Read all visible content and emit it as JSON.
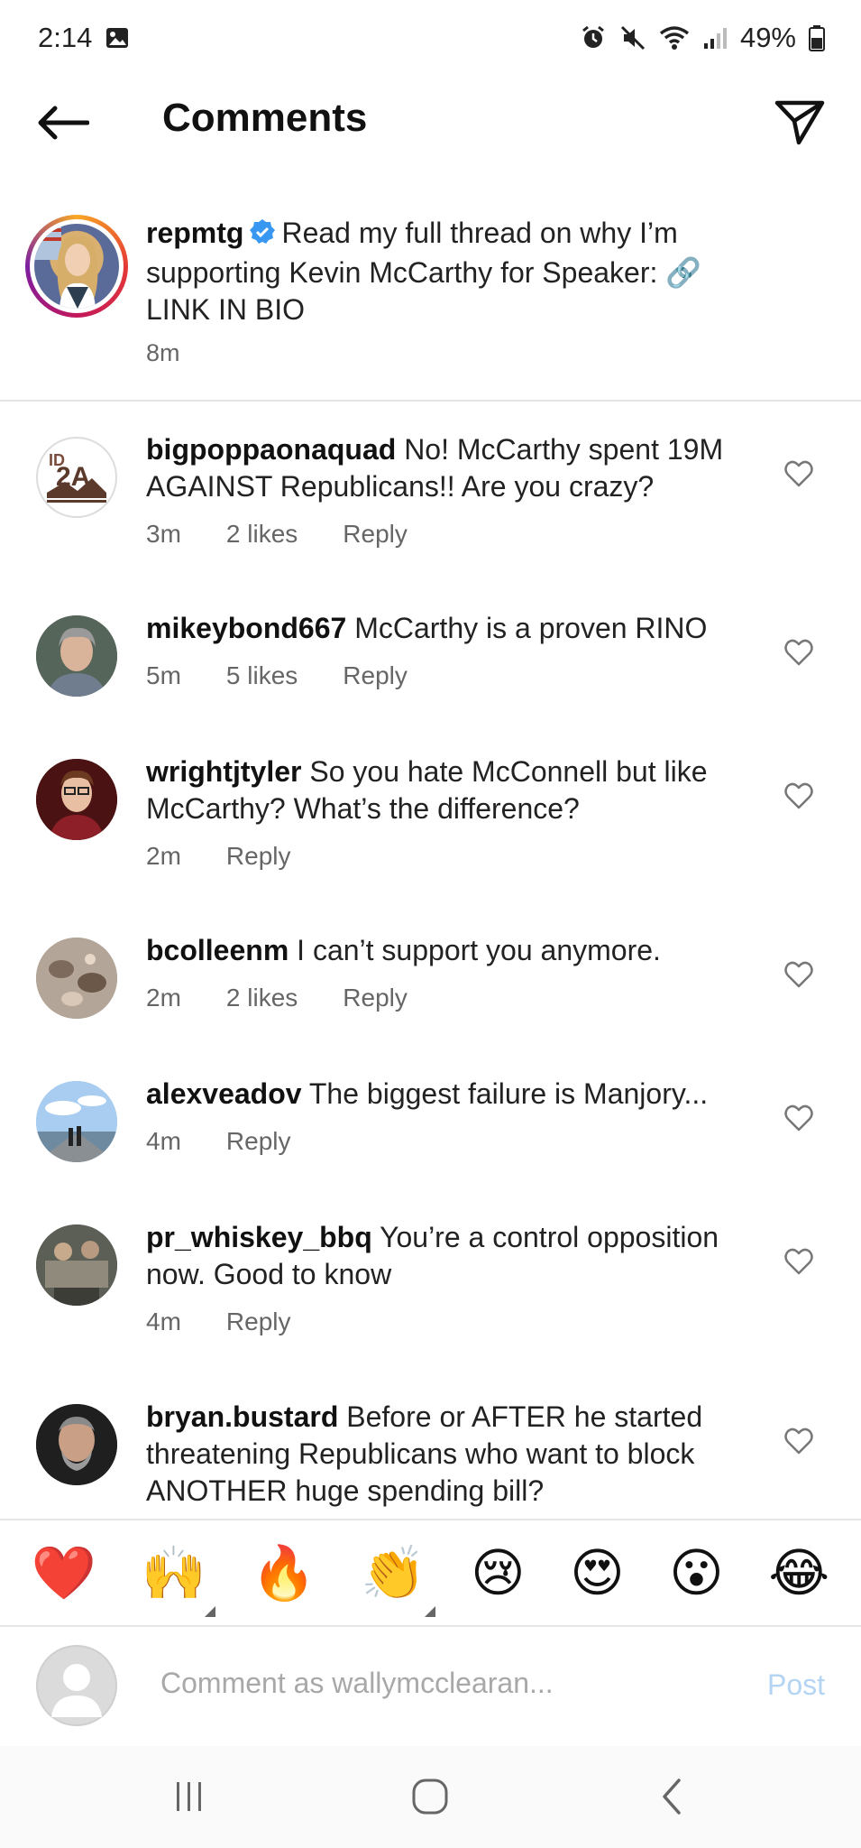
{
  "status_bar": {
    "time": "2:14",
    "battery": "49%"
  },
  "header": {
    "title": "Comments"
  },
  "caption": {
    "username": "repmtg",
    "text": "Read my full thread on why I’m supporting Kevin McCarthy for Speaker: 🔗 LINK IN BIO",
    "time": "8m"
  },
  "comments": [
    {
      "username": "bigpoppaonaquad",
      "text": "No! McCarthy spent 19M AGAINST Republicans!! Are you crazy?",
      "time": "3m",
      "likes": "2 likes",
      "reply": "Reply"
    },
    {
      "username": "mikeybond667",
      "text": "McCarthy is a proven RINO",
      "time": "5m",
      "likes": "5 likes",
      "reply": "Reply"
    },
    {
      "username": "wrightjtyler",
      "text": "So you hate McConnell but like McCarthy? What’s the difference?",
      "time": "2m",
      "likes": "",
      "reply": "Reply"
    },
    {
      "username": "bcolleenm",
      "text": "I can’t support you anymore.",
      "time": "2m",
      "likes": "2 likes",
      "reply": "Reply"
    },
    {
      "username": "alexveadov",
      "text": "The biggest failure is Manjory...",
      "time": "4m",
      "likes": "",
      "reply": "Reply"
    },
    {
      "username": "pr_whiskey_bbq",
      "text": "You’re a control opposition now. Good to know",
      "time": "4m",
      "likes": "",
      "reply": "Reply"
    },
    {
      "username": "bryan.bustard",
      "text": "Before or AFTER he started threatening Republicans who want to block ANOTHER huge spending bill?",
      "time": "",
      "likes": "",
      "reply": ""
    }
  ],
  "emoji_bar": [
    "❤️",
    "🙌",
    "🔥",
    "👏",
    "😢",
    "😍",
    "😮",
    "😂"
  ],
  "comment_input": {
    "placeholder": "Comment as wallymcclearan...",
    "post_label": "Post"
  },
  "avatar_badge": {
    "logo_text": "2A"
  }
}
